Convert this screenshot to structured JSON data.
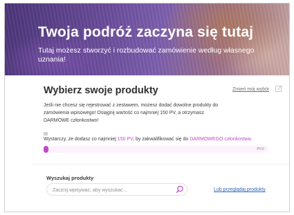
{
  "hero": {
    "title": "Twoja podróż zaczyna się tutaj",
    "subtitle": "Tutaj możesz stworzyć i rozbudować zamówienie według własnego uznania!"
  },
  "products": {
    "title": "Wybierz swoje produkty",
    "change_link": "Zmień mój wybór",
    "intro": "Jeśli nie chcesz się rejestrować z zestawem, możesz dodać dowolne produkty do zamówienia wpisowego! Osiągnij wartość co najmniej 150 PV, a otrzymasz DARMOWE członkostwo!",
    "qualify": {
      "prefix": "Wystarczy, że dodasz co najmniej ",
      "pv": "150 PV",
      "middle": ", by zakwalifikować się do ",
      "member": "DARMOWEGO członkostwa",
      "suffix": "."
    },
    "progress": {
      "label": "PV:0",
      "percent": 2
    }
  },
  "search": {
    "label": "Wyszukaj produkty",
    "placeholder": "Zacznij wpisywać, aby wyszukać...",
    "value": "",
    "browse_link": "Lub przeglądaj produkty"
  },
  "colors": {
    "accent": "#c149c8",
    "link": "#2b63b6"
  },
  "icons": {
    "edit": "edit-icon",
    "search": "search-icon",
    "info": "info-icon"
  }
}
